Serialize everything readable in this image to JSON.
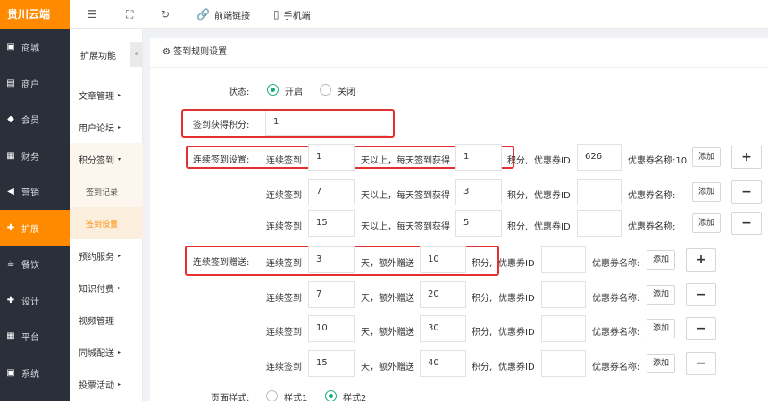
{
  "brand": "贵川云端",
  "sidebar": {
    "items": [
      {
        "label": "商城",
        "icon": "shop-icon"
      },
      {
        "label": "商户",
        "icon": "merchant-icon"
      },
      {
        "label": "会员",
        "icon": "member-icon"
      },
      {
        "label": "财务",
        "icon": "finance-icon"
      },
      {
        "label": "营销",
        "icon": "marketing-icon"
      },
      {
        "label": "扩展",
        "icon": "extension-icon",
        "active": true
      },
      {
        "label": "餐饮",
        "icon": "food-icon"
      },
      {
        "label": "设计",
        "icon": "design-icon"
      },
      {
        "label": "平台",
        "icon": "platform-icon"
      },
      {
        "label": "系统",
        "icon": "system-icon"
      }
    ]
  },
  "toolbar": {
    "frontend_link": "前端链接",
    "mobile": "手机端"
  },
  "submenu": {
    "title": "扩展功能",
    "items": [
      {
        "label": "文章管理"
      },
      {
        "label": "用户论坛"
      },
      {
        "label": "积分签到"
      },
      {
        "label": "签到记录"
      },
      {
        "label": "签到设置"
      },
      {
        "label": "预约服务"
      },
      {
        "label": "知识付费"
      },
      {
        "label": "视频管理"
      },
      {
        "label": "同城配送"
      },
      {
        "label": "投票活动"
      }
    ]
  },
  "panel": {
    "title": "签到规则设置",
    "status_label": "状态:",
    "status_on": "开启",
    "status_off": "关闭",
    "points_label": "签到获得积分:",
    "points_value": "1",
    "continuous_label": "连续签到设置:",
    "gift_label": "连续签到赠送:",
    "continuous_rows": [
      {
        "prefix": "连续签到",
        "days": "1",
        "mid": "天以上，每天签到获得",
        "points": "1",
        "unit": "积分,",
        "coupon_label": "优惠券ID",
        "coupon_id": "626",
        "coupon_name": "优惠券名称:10",
        "add": "添加",
        "op": "+"
      },
      {
        "prefix": "连续签到",
        "days": "7",
        "mid": "天以上，每天签到获得",
        "points": "3",
        "unit": "积分,",
        "coupon_label": "优惠券ID",
        "coupon_id": "",
        "coupon_name": "优惠券名称:",
        "add": "添加",
        "op": "−"
      },
      {
        "prefix": "连续签到",
        "days": "15",
        "mid": "天以上，每天签到获得",
        "points": "5",
        "unit": "积分,",
        "coupon_label": "优惠券ID",
        "coupon_id": "",
        "coupon_name": "优惠券名称:",
        "add": "添加",
        "op": "−"
      }
    ],
    "gift_rows": [
      {
        "prefix": "连续签到",
        "days": "3",
        "mid": "天，额外赠送",
        "points": "10",
        "unit": "积分,",
        "coupon_label": "优惠券ID",
        "coupon_id": "",
        "coupon_name": "优惠券名称:",
        "add": "添加",
        "op": "+"
      },
      {
        "prefix": "连续签到",
        "days": "7",
        "mid": "天，额外赠送",
        "points": "20",
        "unit": "积分,",
        "coupon_label": "优惠券ID",
        "coupon_id": "",
        "coupon_name": "优惠券名称:",
        "add": "添加",
        "op": "−"
      },
      {
        "prefix": "连续签到",
        "days": "10",
        "mid": "天，额外赠送",
        "points": "30",
        "unit": "积分,",
        "coupon_label": "优惠券ID",
        "coupon_id": "",
        "coupon_name": "优惠券名称:",
        "add": "添加",
        "op": "−"
      },
      {
        "prefix": "连续签到",
        "days": "15",
        "mid": "天，额外赠送",
        "points": "40",
        "unit": "积分,",
        "coupon_label": "优惠券ID",
        "coupon_id": "",
        "coupon_name": "优惠券名称:",
        "add": "添加",
        "op": "−"
      }
    ],
    "style_label": "页面样式:",
    "style1": "样式1",
    "style2": "样式2"
  },
  "colors": {
    "accent": "#ff8a00",
    "sidebar_bg": "#2b2f3a",
    "radio": "#1aad78",
    "highlight": "#e33030"
  }
}
